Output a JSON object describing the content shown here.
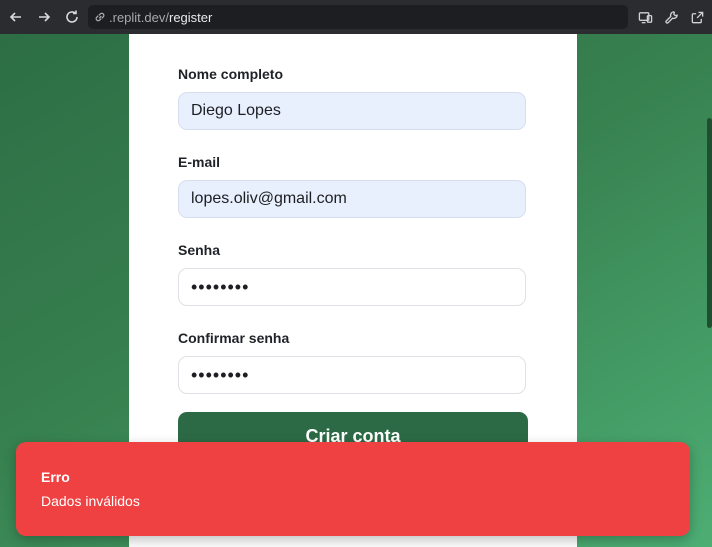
{
  "browser": {
    "url_prefix": ".replit.dev/",
    "url_path": "register"
  },
  "form": {
    "name_label": "Nome completo",
    "name_value": "Diego Lopes",
    "email_label": "E-mail",
    "email_value": "lopes.oliv@gmail.com",
    "password_label": "Senha",
    "password_value": "••••••••",
    "confirm_label": "Confirmar senha",
    "confirm_value": "••••••••",
    "submit_label": "Criar conta"
  },
  "toast": {
    "title": "Erro",
    "message": "Dados inválidos"
  },
  "colors": {
    "brand_green": "#2c6a45",
    "error_red": "#ef4142"
  },
  "icons": [
    "back-icon",
    "forward-icon",
    "reload-icon",
    "link-icon",
    "devices-icon",
    "wrench-icon",
    "open-external-icon"
  ]
}
